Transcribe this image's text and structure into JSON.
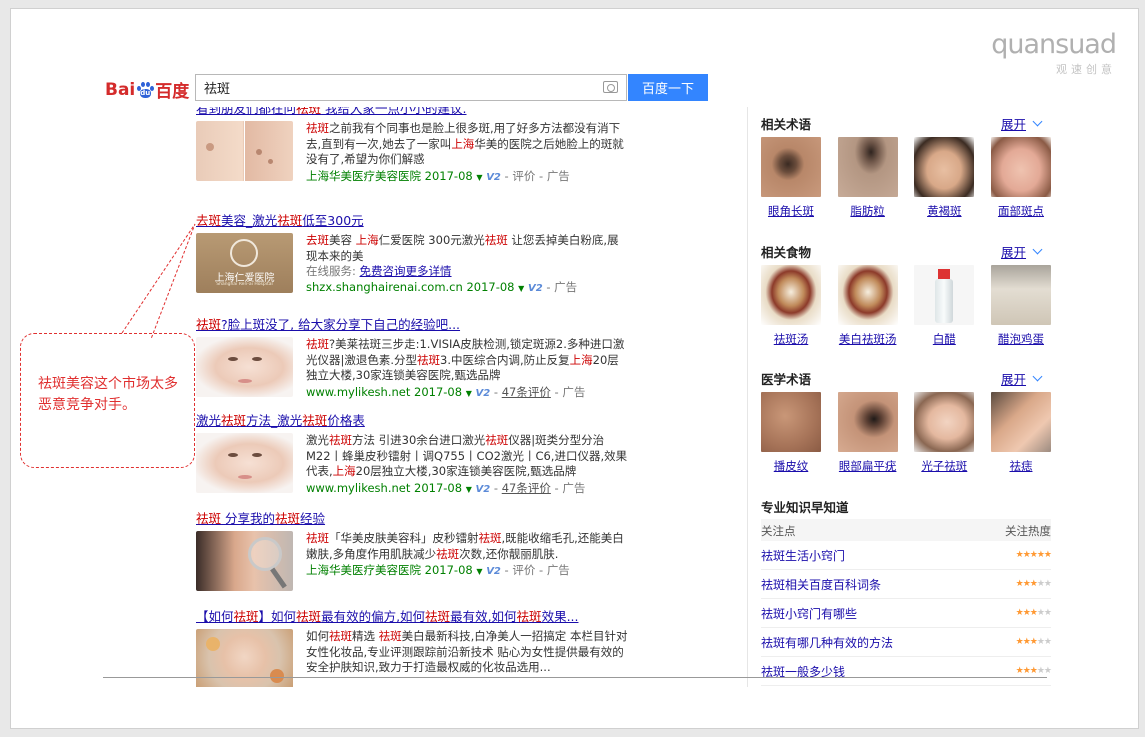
{
  "brand": {
    "name": "quansuad",
    "sub": "观速创意"
  },
  "header": {
    "logo_text_left": "Bai",
    "logo_text_mid": "du",
    "logo_text_right": "百度",
    "search_value": "祛斑",
    "search_button": "百度一下"
  },
  "results": [
    {
      "title": [
        {
          "t": "看到朋友们都在问",
          "h": false
        },
        {
          "t": "祛斑",
          "h": true
        },
        {
          "t": " 我给大家一点小小的建议.",
          "h": false
        }
      ],
      "text": [
        {
          "t": "祛斑",
          "h": true
        },
        {
          "t": "之前我有个同事也是脸上很多斑,用了好多方法都没有消下去,直到有一次,她去了一家叫",
          "h": false
        },
        {
          "t": "上海",
          "h": true
        },
        {
          "t": "华美的医院之后她脸上的斑就没有了,希望为你们解惑",
          "h": false
        }
      ],
      "site": "上海华美医疗美容医院",
      "date": "2017-08",
      "tail": "- 评价 - 广告"
    },
    {
      "title": [
        {
          "t": "去斑",
          "h": true
        },
        {
          "t": "美容_激光",
          "h": false
        },
        {
          "t": "祛斑",
          "h": true
        },
        {
          "t": "低至300元",
          "h": false
        }
      ],
      "text": [
        {
          "t": "去斑",
          "h": true
        },
        {
          "t": "美容 ",
          "h": false
        },
        {
          "t": "上海",
          "h": true
        },
        {
          "t": "仁爱医院 300元激光",
          "h": false
        },
        {
          "t": "祛斑",
          "h": true
        },
        {
          "t": " 让您丢掉美白粉底,展现本来的美",
          "h": false
        }
      ],
      "service_label": "在线服务:",
      "service_link": "免费咨询更多详情",
      "site": "shzx.shanghairenai.com.cn",
      "date": "2017-08",
      "tail": "- 广告",
      "thumb_text": "上海仁爱医院",
      "thumb_sub": "Shanghai Ren-ai Hospital"
    },
    {
      "title": [
        {
          "t": "祛斑",
          "h": true
        },
        {
          "t": "?脸上斑没了, 给大家分享下自己的经验吧...",
          "h": false
        }
      ],
      "text": [
        {
          "t": "祛斑",
          "h": true
        },
        {
          "t": "?美莱祛斑三步走:1.VISIA皮肤检测,锁定斑源2.多种进口激光仪器|激退色素.分型",
          "h": false
        },
        {
          "t": "祛斑",
          "h": true
        },
        {
          "t": "3.中医综合内调,防止反复",
          "h": false
        },
        {
          "t": "上海",
          "h": true
        },
        {
          "t": "20层独立大楼,30家连锁美容医院,甄选品牌",
          "h": false
        }
      ],
      "site": "www.mylikesh.net",
      "date": "2017-08",
      "tail_link": "47条评价",
      "tail": "- 广告"
    },
    {
      "title": [
        {
          "t": "激光",
          "h": false
        },
        {
          "t": "祛斑",
          "h": true
        },
        {
          "t": "方法_激光",
          "h": false
        },
        {
          "t": "祛斑",
          "h": true
        },
        {
          "t": "价格表",
          "h": false
        }
      ],
      "text": [
        {
          "t": "激光",
          "h": false
        },
        {
          "t": "祛斑",
          "h": true
        },
        {
          "t": "方法 引进30余台进口激光",
          "h": false
        },
        {
          "t": "祛斑",
          "h": true
        },
        {
          "t": "仪器|斑类分型分治 M22丨蜂巢皮秒镭射丨调Q755丨CO2激光丨C6,进口仪器,效果代表,",
          "h": false
        },
        {
          "t": "上海",
          "h": true
        },
        {
          "t": "20层独立大楼,30家连锁美容医院,甄选品牌",
          "h": false
        }
      ],
      "site": "www.mylikesh.net",
      "date": "2017-08",
      "tail_link": "47条评价",
      "tail": "- 广告"
    },
    {
      "title": [
        {
          "t": "祛斑",
          "h": true
        },
        {
          "t": " 分享我的",
          "h": false
        },
        {
          "t": "祛斑",
          "h": true
        },
        {
          "t": "经验",
          "h": false
        }
      ],
      "text": [
        {
          "t": "祛斑",
          "h": true
        },
        {
          "t": "「华美皮肤美容科」皮秒镭射",
          "h": false
        },
        {
          "t": "祛斑",
          "h": true
        },
        {
          "t": ",既能收缩毛孔,还能美白嫩肤,多角度作用肌肤减少",
          "h": false
        },
        {
          "t": "祛斑",
          "h": true
        },
        {
          "t": "次数,还你靓丽肌肤.",
          "h": false
        }
      ],
      "site": "上海华美医疗美容医院",
      "date": "2017-08",
      "tail": "- 评价 - 广告"
    },
    {
      "title": [
        {
          "t": "【如何",
          "h": false
        },
        {
          "t": "祛斑",
          "h": true
        },
        {
          "t": "】如何",
          "h": false
        },
        {
          "t": "祛斑",
          "h": true
        },
        {
          "t": "最有效的偏方,如何",
          "h": false
        },
        {
          "t": "祛斑",
          "h": true
        },
        {
          "t": "最有效,如何",
          "h": false
        },
        {
          "t": "祛斑",
          "h": true
        },
        {
          "t": "效果...",
          "h": false
        }
      ],
      "text": [
        {
          "t": "如何",
          "h": false
        },
        {
          "t": "祛斑",
          "h": true
        },
        {
          "t": "精选 ",
          "h": false
        },
        {
          "t": "祛斑",
          "h": true
        },
        {
          "t": "美白最新科技,白净美人一招搞定 本栏目针对女性化妆品,专业评测跟踪前沿新技术 贴心为女性提供最有效的安全护肤知识,致力于打造最权威的化妆品选用...",
          "h": false
        }
      ]
    }
  ],
  "callout": {
    "text": "祛斑美容这个市场太多恶意竞争对手。"
  },
  "sidebar": {
    "expand_label": "展开",
    "related_terms": {
      "title": "相关术语",
      "items": [
        "眼角长斑",
        "脂肪粒",
        "黄褐斑",
        "面部斑点"
      ]
    },
    "related_food": {
      "title": "相关食物",
      "items": [
        "祛斑汤",
        "美白祛斑汤",
        "白醋",
        "醋泡鸡蛋"
      ]
    },
    "medical_terms": {
      "title": "医学术语",
      "items": [
        "播皮纹",
        "眼部扁平疣",
        "光子祛斑",
        "祛痣"
      ]
    },
    "knowledge": {
      "title": "专业知识早知道",
      "col1": "关注点",
      "col2": "关注热度",
      "rows": [
        {
          "q": "祛斑生活小窍门",
          "stars": 5
        },
        {
          "q": "祛斑相关百度百科词条",
          "stars": 3
        },
        {
          "q": "祛斑小窍门有哪些",
          "stars": 3
        },
        {
          "q": "祛斑有哪几种有效的方法",
          "stars": 3
        },
        {
          "q": "祛斑一般多少钱",
          "stars": 3
        }
      ]
    }
  },
  "colors": {
    "accent": "#3385ff",
    "link": "#1a0dab",
    "highlight": "#cc0000",
    "url_green": "#008000",
    "callout_red": "#e03030"
  }
}
